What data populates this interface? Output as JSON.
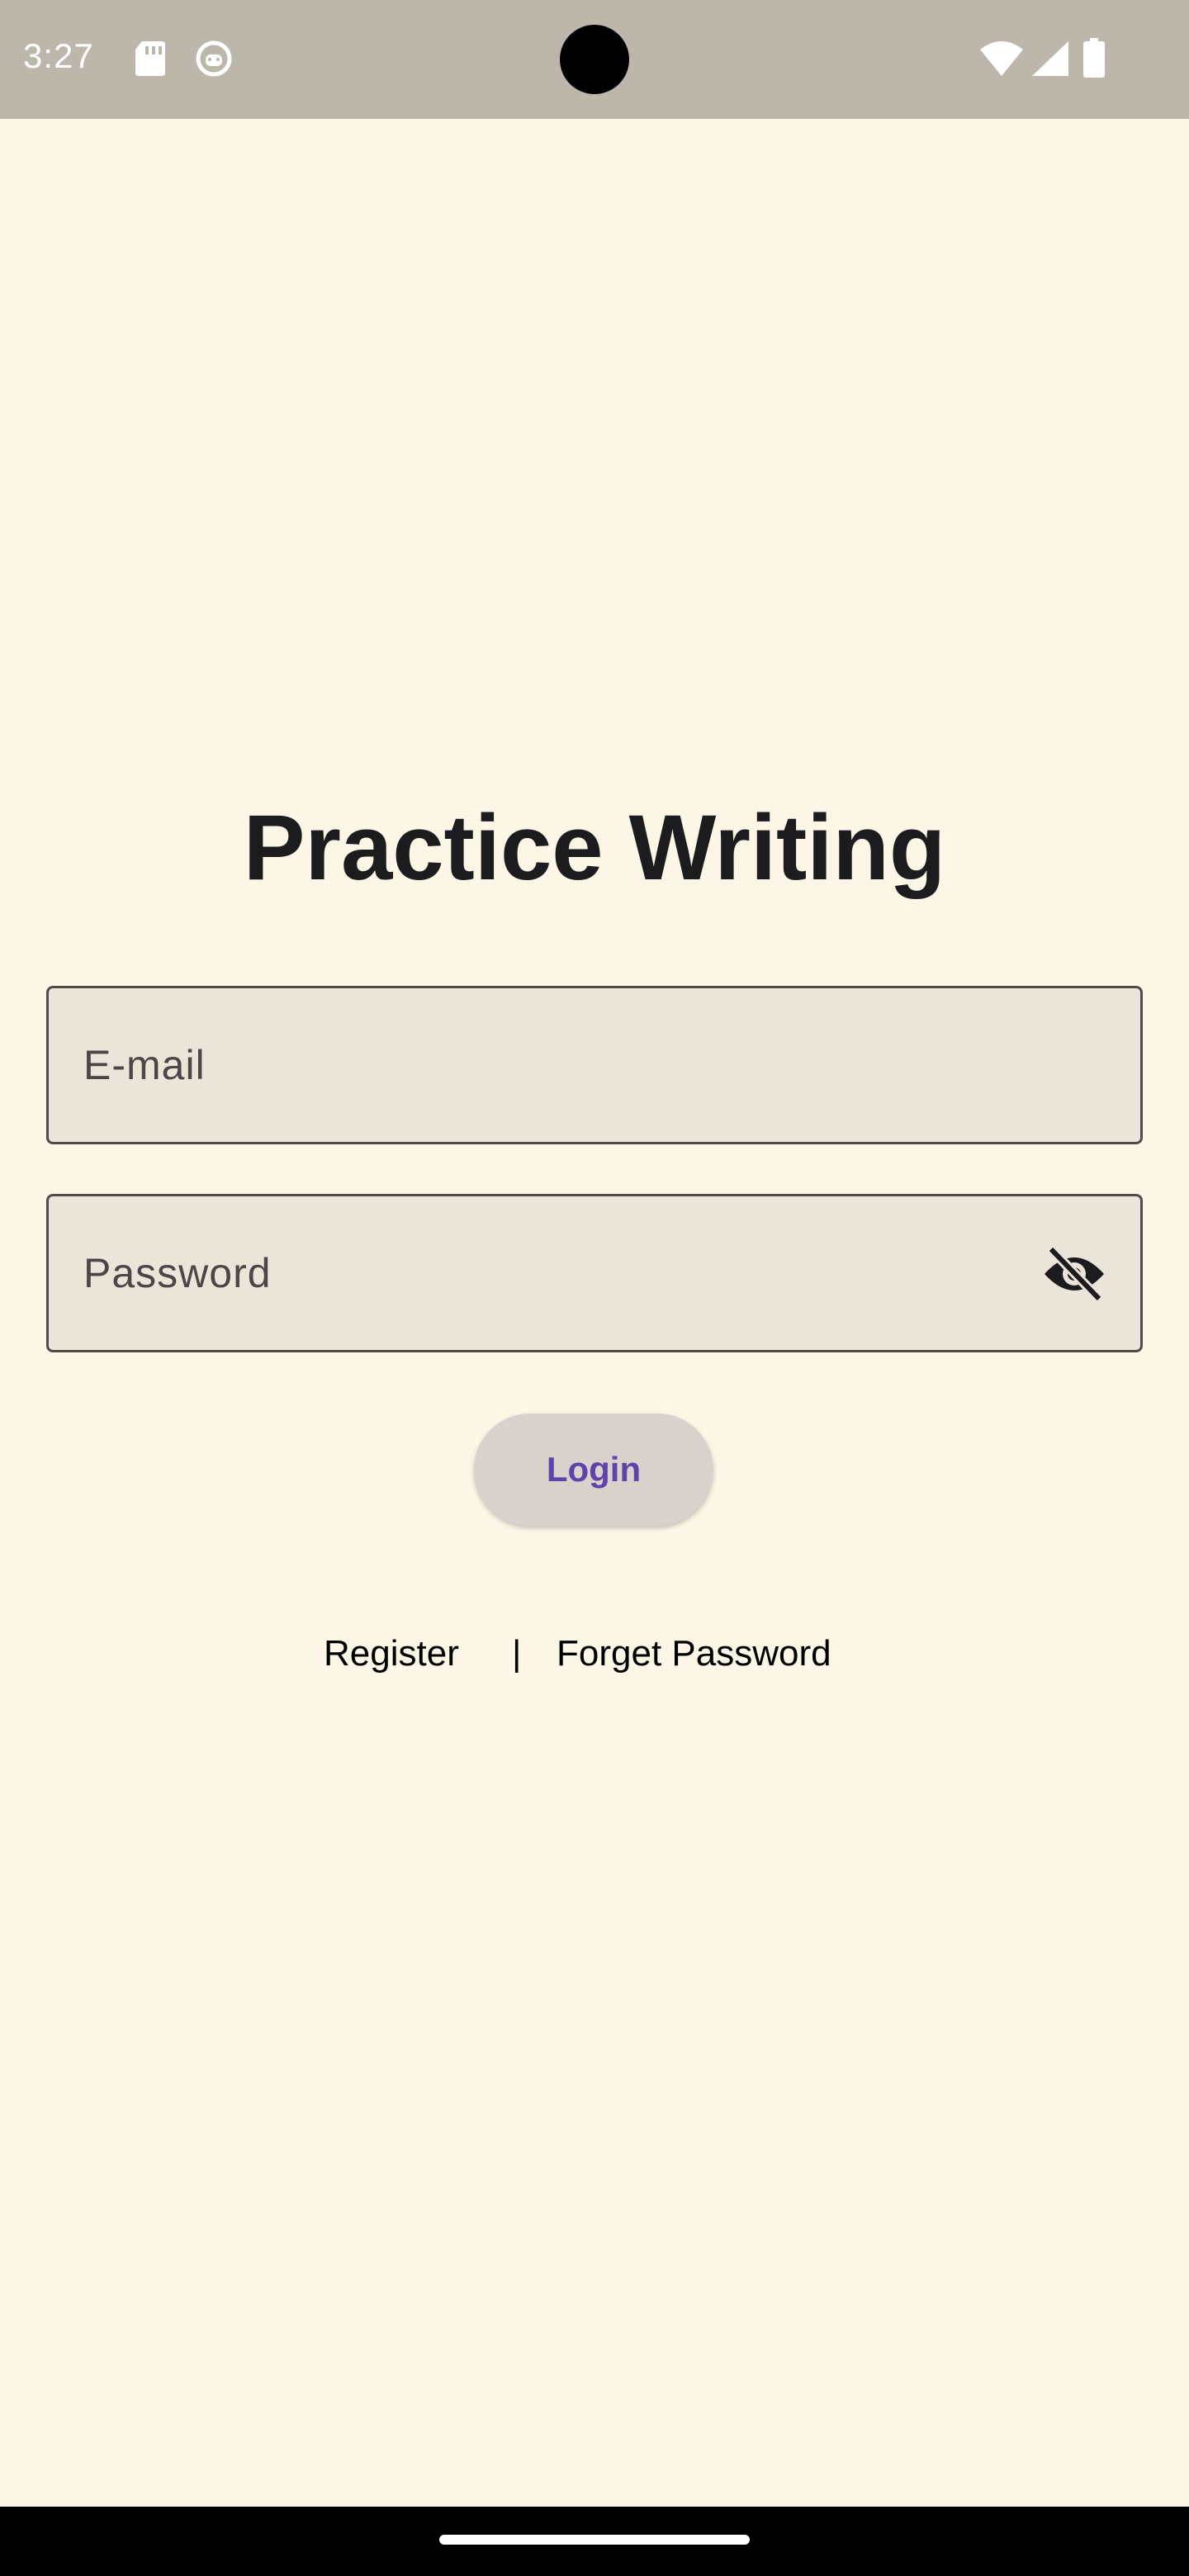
{
  "status_bar": {
    "time": "3:27",
    "icons_left": [
      "sd-card-icon",
      "android-debug-icon"
    ],
    "icons_right": [
      "wifi-icon",
      "cellular-signal-icon",
      "battery-icon"
    ]
  },
  "app": {
    "title": "Practice Writing"
  },
  "form": {
    "email_placeholder": "E-mail",
    "password_placeholder": "Password",
    "visibility_toggle_icon": "visibility-off-icon",
    "login_label": "Login"
  },
  "links": {
    "register_label": "Register",
    "separator": "|",
    "forget_password_label": "Forget Password"
  },
  "colors": {
    "background": "#fcf6e6",
    "status_bar": "#bdb7ab",
    "field_fill": "#ebe4d9",
    "button_fill": "#d9d1cc",
    "button_text": "#5f43a8"
  }
}
